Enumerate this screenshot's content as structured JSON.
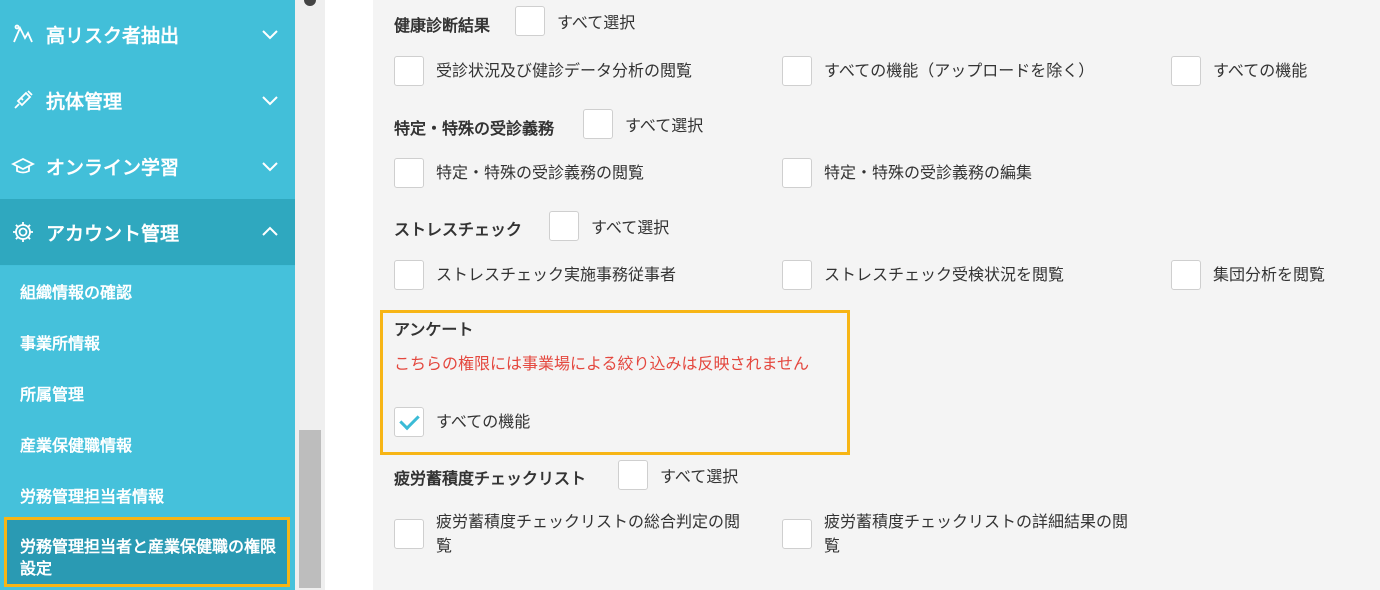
{
  "sidebar": {
    "menu": [
      {
        "label": "高リスク者抽出",
        "icon": "risk-icon",
        "expanded": false
      },
      {
        "label": "抗体管理",
        "icon": "syringe-icon",
        "expanded": false
      },
      {
        "label": "オンライン学習",
        "icon": "graduation-cap-icon",
        "expanded": false
      },
      {
        "label": "アカウント管理",
        "icon": "gear-icon",
        "expanded": true
      }
    ],
    "submenu": [
      "組織情報の確認",
      "事業所情報",
      "所属管理",
      "産業保健職情報",
      "労務管理担当者情報",
      "労務管理担当者と産業保健職の権限設定"
    ]
  },
  "content": {
    "health_checkup": {
      "title": "健康診断結果",
      "select_all": "すべて選択",
      "options": [
        "受診状況及び健診データ分析の閲覧",
        "すべての機能（アップロードを除く）",
        "すべての機能"
      ]
    },
    "special_exam": {
      "title": "特定・特殊の受診義務",
      "select_all": "すべて選択",
      "options": [
        "特定・特殊の受診義務の閲覧",
        "特定・特殊の受診義務の編集"
      ]
    },
    "stress_check": {
      "title": "ストレスチェック",
      "select_all": "すべて選択",
      "options": [
        "ストレスチェック実施事務従事者",
        "ストレスチェック受検状況を閲覧",
        "集団分析を閲覧"
      ]
    },
    "survey": {
      "title": "アンケート",
      "warning": "こちらの権限には事業場による絞り込みは反映されません",
      "option": "すべての機能",
      "checked": true
    },
    "fatigue": {
      "title": "疲労蓄積度チェックリスト",
      "select_all": "すべて選択",
      "options": [
        "疲労蓄積度チェックリストの総合判定の閲覧",
        "疲労蓄積度チェックリストの詳細結果の閲覧"
      ]
    }
  },
  "colors": {
    "sidebar_bg": "#42bfd9",
    "sidebar_active": "#2fa8bf",
    "highlight_border": "#f7b515",
    "warning_text": "#e4473e",
    "check_color": "#3bbbd6"
  }
}
